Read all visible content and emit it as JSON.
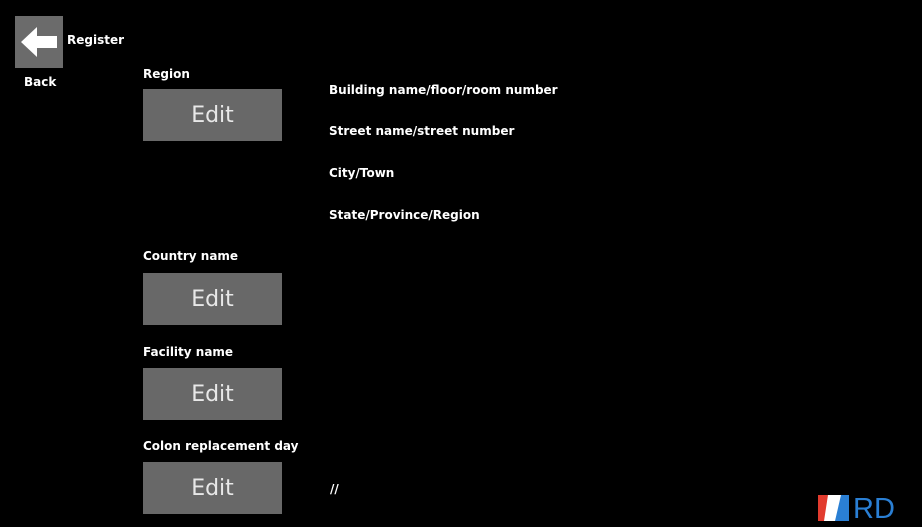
{
  "header": {
    "title": "Register",
    "back_label": "Back"
  },
  "sections": {
    "region": {
      "label": "Region",
      "edit_label": "Edit",
      "address_lines": [
        "Building name/floor/room number",
        "Street name/street number",
        "City/Town",
        "State/Province/Region"
      ]
    },
    "country": {
      "label": "Country name",
      "edit_label": "Edit"
    },
    "facility": {
      "label": "Facility name",
      "edit_label": "Edit"
    },
    "colon_replacement": {
      "label": "Colon replacement day",
      "edit_label": "Edit",
      "value": "//"
    }
  },
  "logo": {
    "text": "RD",
    "colors": {
      "red": "#e23b2e",
      "blue": "#2a7fd4"
    }
  },
  "colors": {
    "background": "#000000",
    "button": "#686868",
    "text": "#ffffff"
  }
}
